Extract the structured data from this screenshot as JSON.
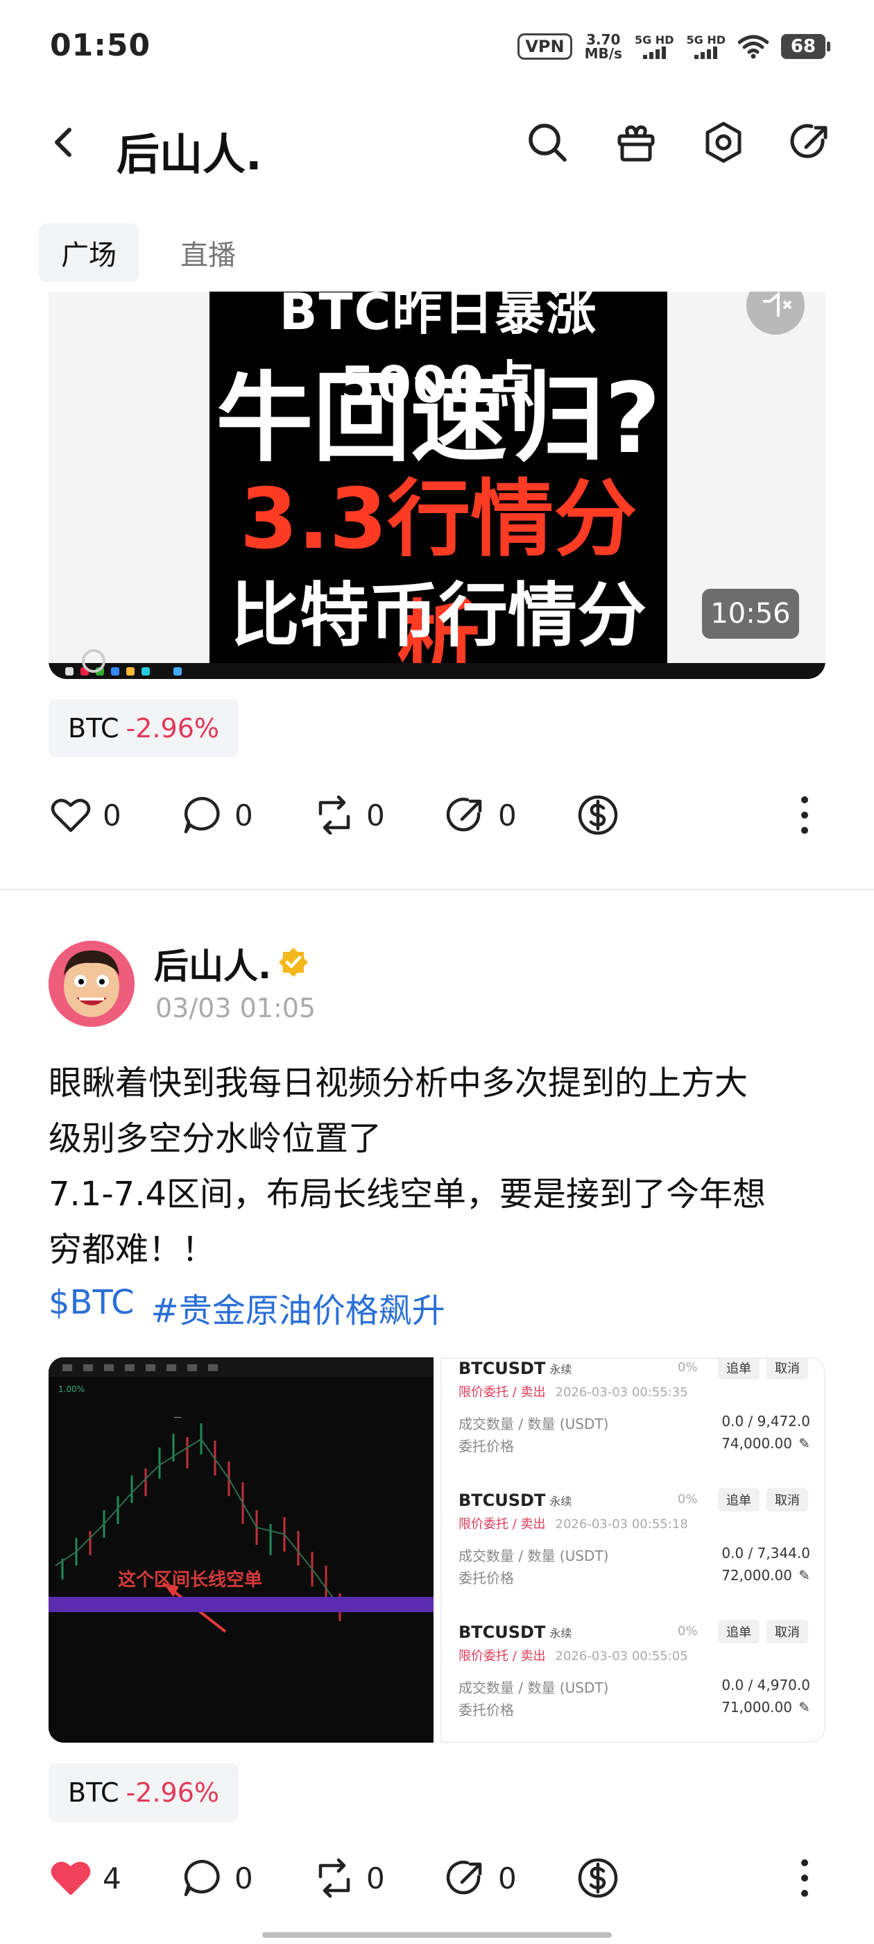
{
  "status": {
    "time": "01:50",
    "vpn": "VPN",
    "speed_value": "3.70",
    "speed_unit": "MB/s",
    "net1": "5G HD",
    "net2": "5G HD",
    "battery": "68"
  },
  "header": {
    "title": "后山人.",
    "icons": [
      "back-icon",
      "search-icon",
      "gift-icon",
      "settings-icon",
      "share-icon"
    ]
  },
  "tabs": [
    {
      "label": "广场",
      "active": true
    },
    {
      "label": "直播",
      "active": false
    }
  ],
  "video": {
    "line1": "BTC昨日暴涨5000点",
    "line2": "牛回速归?",
    "line3": "3.3行情分析",
    "line4": "比特币行情分析",
    "duration": "10:56"
  },
  "post1": {
    "chip": {
      "symbol": "BTC",
      "change": "-2.96%"
    },
    "actions": {
      "likes": "0",
      "comments": "0",
      "reposts": "0",
      "shares": "0"
    }
  },
  "post2": {
    "author": "后山人.",
    "time": "03/03 01:05",
    "text_lines": [
      "眼瞅着快到我每日视频分析中多次提到的上方大",
      "级别多空分水岭位置了",
      "7.1-7.4区间，布局长线空单，要是接到了今年想",
      "穷都难！！"
    ],
    "hashtags": [
      "$BTC",
      "#贵金原油价格飙升"
    ],
    "chart_label": "这个区间长线空单",
    "orders": [
      {
        "symbol": "BTCUSDT",
        "tag": "永续",
        "pct": "0%",
        "btn1": "追单",
        "btn2": "取消",
        "side": "限价委托 / 卖出",
        "time": "2026-03-03 00:55:35",
        "l1": "成交数量 / 数量 (USDT)",
        "v1": "0.0 / 9,472.0",
        "l2": "委托价格",
        "v2": "74,000.00"
      },
      {
        "symbol": "BTCUSDT",
        "tag": "永续",
        "pct": "0%",
        "btn1": "追单",
        "btn2": "取消",
        "side": "限价委托 / 卖出",
        "time": "2026-03-03 00:55:18",
        "l1": "成交数量 / 数量 (USDT)",
        "v1": "0.0 / 7,344.0",
        "l2": "委托价格",
        "v2": "72,000.00"
      },
      {
        "symbol": "BTCUSDT",
        "tag": "永续",
        "pct": "0%",
        "btn1": "追单",
        "btn2": "取消",
        "side": "限价委托 / 卖出",
        "time": "2026-03-03 00:55:05",
        "l1": "成交数量 / 数量 (USDT)",
        "v1": "0.0 / 4,970.0",
        "l2": "委托价格",
        "v2": "71,000.00"
      }
    ],
    "chip": {
      "symbol": "BTC",
      "change": "-2.96%"
    },
    "actions": {
      "likes": "4",
      "comments": "0",
      "reposts": "0",
      "shares": "0"
    },
    "liked": true
  },
  "colors": {
    "accent_red": "#e03a5a",
    "link_blue": "#2a6fd6",
    "like_red": "#f0405a"
  }
}
